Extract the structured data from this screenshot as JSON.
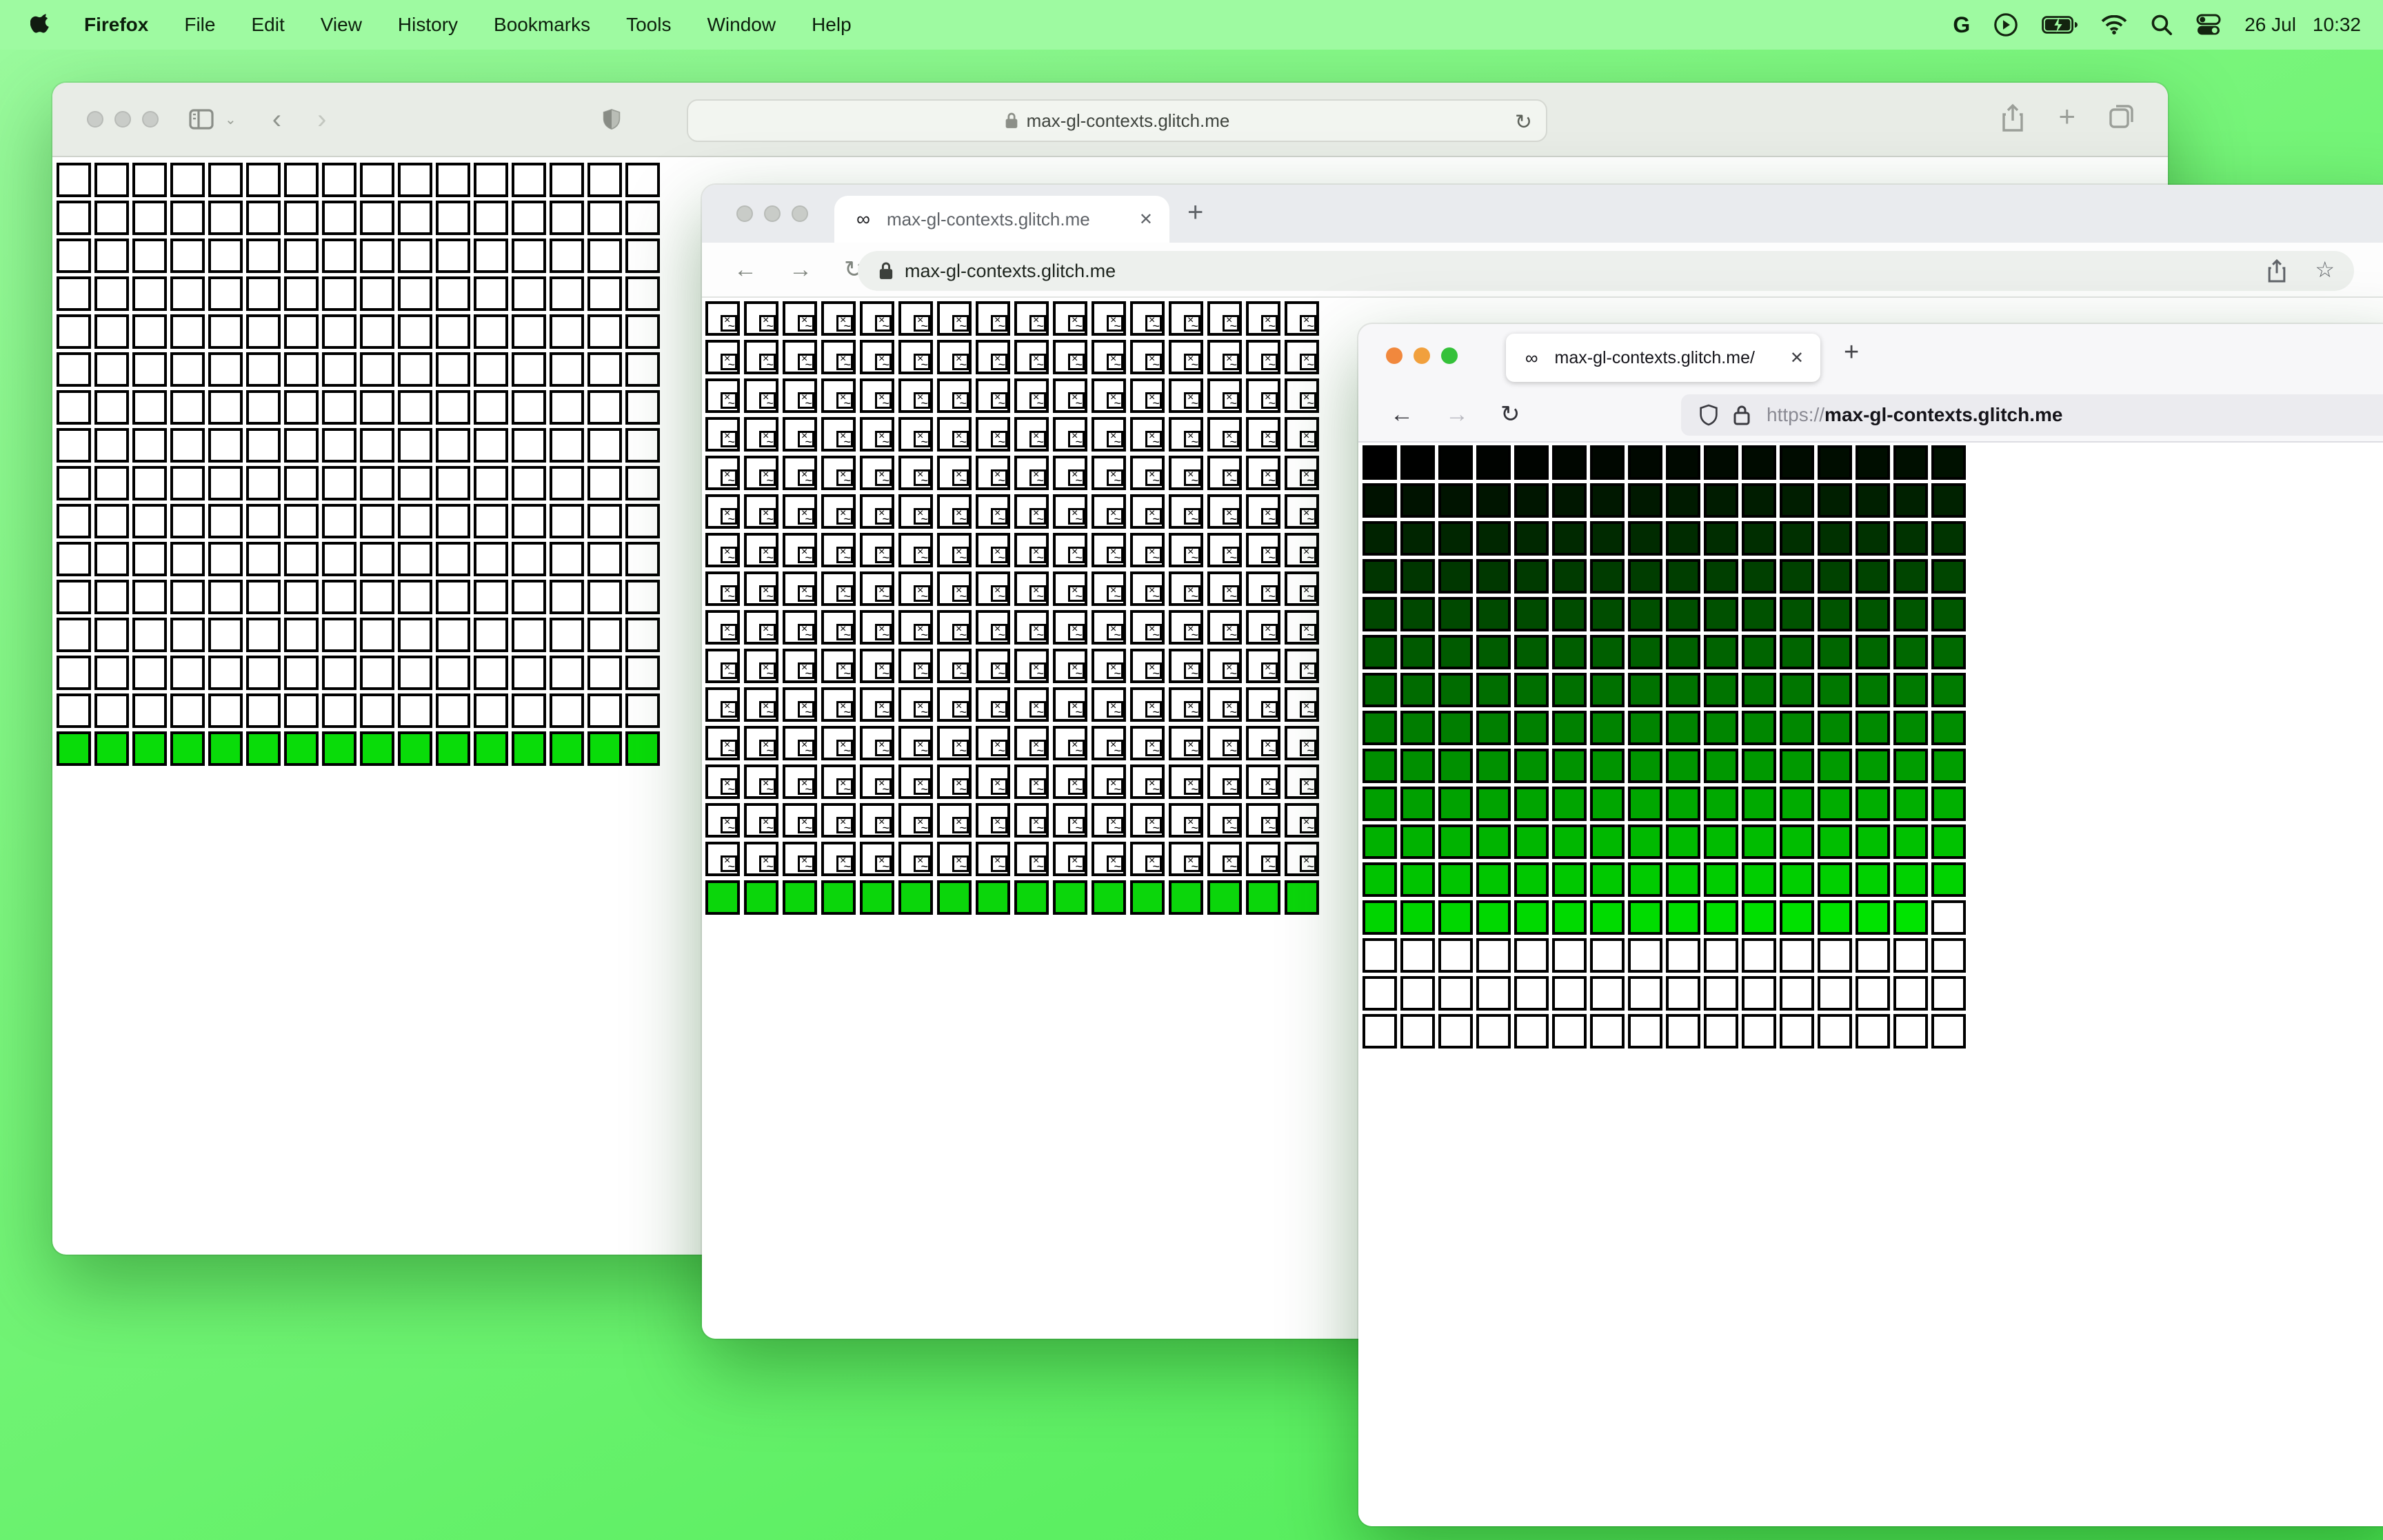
{
  "menu_bar": {
    "app_name": "Firefox",
    "menus": [
      "File",
      "Edit",
      "View",
      "History",
      "Bookmarks",
      "Tools",
      "Window",
      "Help"
    ],
    "google_glyph": "G",
    "date": "26 Jul",
    "time": "10:32"
  },
  "safari_window": {
    "url": "max-gl-contexts.glitch.me",
    "reload_glyph": "↻",
    "back_glyph": "‹",
    "forward_glyph": "›",
    "grid": {
      "cols": 16,
      "rows": 16,
      "plain_rows": 15,
      "cell_fill": "#ffffff",
      "border_color": "#000000",
      "bottom_row_color": "#09dc09",
      "cell": 25,
      "gap": 2.5
    }
  },
  "chrome_window": {
    "tab_favicon": "∞",
    "tab_title": "max-gl-contexts.glitch.me",
    "close_glyph": "✕",
    "newtab_glyph": "+",
    "back_glyph": "←",
    "forward_glyph": "→",
    "reload_glyph": "↻",
    "url": "max-gl-contexts.glitch.me",
    "grid": {
      "cols": 16,
      "rows": 16,
      "broken_rows": 15,
      "cell_fill": "#ffffff",
      "border_color": "#000000",
      "bottom_row_color": "#0bd60b",
      "broken_x": "×",
      "broken_wave": "~",
      "cell": 25,
      "gap": 3
    }
  },
  "firefox_window": {
    "traffic_lights": [
      "#f1883d",
      "#f1a03d",
      "#35c13a"
    ],
    "tab_favicon": "∞",
    "tab_title": "max-gl-contexts.glitch.me/",
    "close_glyph": "✕",
    "newtab_glyph": "+",
    "back_glyph": "←",
    "forward_glyph": "→",
    "reload_glyph": "↻",
    "url_scheme": "https://",
    "url_host": "max-gl-contexts.glitch.me",
    "grid": {
      "cols": 16,
      "rows": 16,
      "colored_cells": 207,
      "ramp_green_start": 0,
      "ramp_green_end": 228,
      "cell_fill": "#ffffff",
      "border_color": "#000000",
      "cell": 25,
      "gap": 2.5
    }
  }
}
